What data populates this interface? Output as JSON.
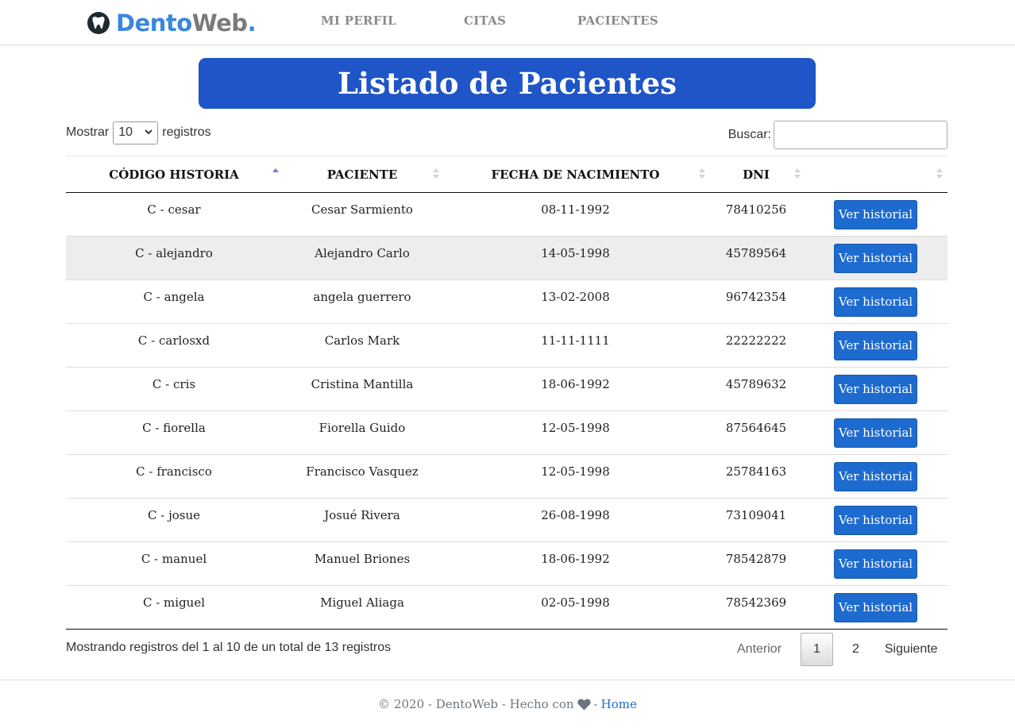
{
  "navbar": {
    "brand": {
      "part1": "Dento",
      "part2": "Web",
      "part3": "."
    },
    "links": [
      "MI PERFIL",
      "CITAS",
      "PACIENTES"
    ]
  },
  "page": {
    "title": "Listado de Pacientes"
  },
  "controls": {
    "show_label": "Mostrar",
    "page_size": "10",
    "records_label": "registros",
    "search_label": "Buscar:",
    "search_value": ""
  },
  "table": {
    "headers": [
      "CÓDIGO HISTORIA",
      "PACIENTE",
      "FECHA DE NACIMIENTO",
      "DNI",
      ""
    ],
    "sorted_column": 0,
    "sort_direction": "asc",
    "action_label": "Ver historial",
    "rows": [
      {
        "codigo": "C - cesar",
        "paciente": "Cesar Sarmiento",
        "fecha": "08-11-1992",
        "dni": "78410256"
      },
      {
        "codigo": "C - alejandro",
        "paciente": "Alejandro Carlo",
        "fecha": "14-05-1998",
        "dni": "45789564"
      },
      {
        "codigo": "C - angela",
        "paciente": "angela guerrero",
        "fecha": "13-02-2008",
        "dni": "96742354"
      },
      {
        "codigo": "C - carlosxd",
        "paciente": "Carlos Mark",
        "fecha": "11-11-1111",
        "dni": "22222222"
      },
      {
        "codigo": "C - cris",
        "paciente": "Cristina Mantilla",
        "fecha": "18-06-1992",
        "dni": "45789632"
      },
      {
        "codigo": "C - fiorella",
        "paciente": "Fiorella Guido",
        "fecha": "12-05-1998",
        "dni": "87564645"
      },
      {
        "codigo": "C - francisco",
        "paciente": "Francisco Vasquez",
        "fecha": "12-05-1998",
        "dni": "25784163"
      },
      {
        "codigo": "C - josue",
        "paciente": "Josué Rivera",
        "fecha": "26-08-1998",
        "dni": "73109041"
      },
      {
        "codigo": "C - manuel",
        "paciente": "Manuel Briones",
        "fecha": "18-06-1992",
        "dni": "78542879"
      },
      {
        "codigo": "C - miguel",
        "paciente": "Miguel Aliaga",
        "fecha": "02-05-1998",
        "dni": "78542369"
      }
    ]
  },
  "info": "Mostrando registros del 1 al 10 de un total de 13 registros",
  "pagination": {
    "previous": "Anterior",
    "pages": [
      "1",
      "2"
    ],
    "current": "1",
    "next": "Siguiente"
  },
  "footer": {
    "text": "© 2020 - DentoWeb - Hecho con",
    "separator": "-",
    "link": "Home",
    "icon": "heart-icon"
  },
  "colors": {
    "brand_blue": "#3a86e0",
    "banner": "#1f55c6",
    "button": "#1e6bd0",
    "nav_text": "#8a8a8a"
  }
}
